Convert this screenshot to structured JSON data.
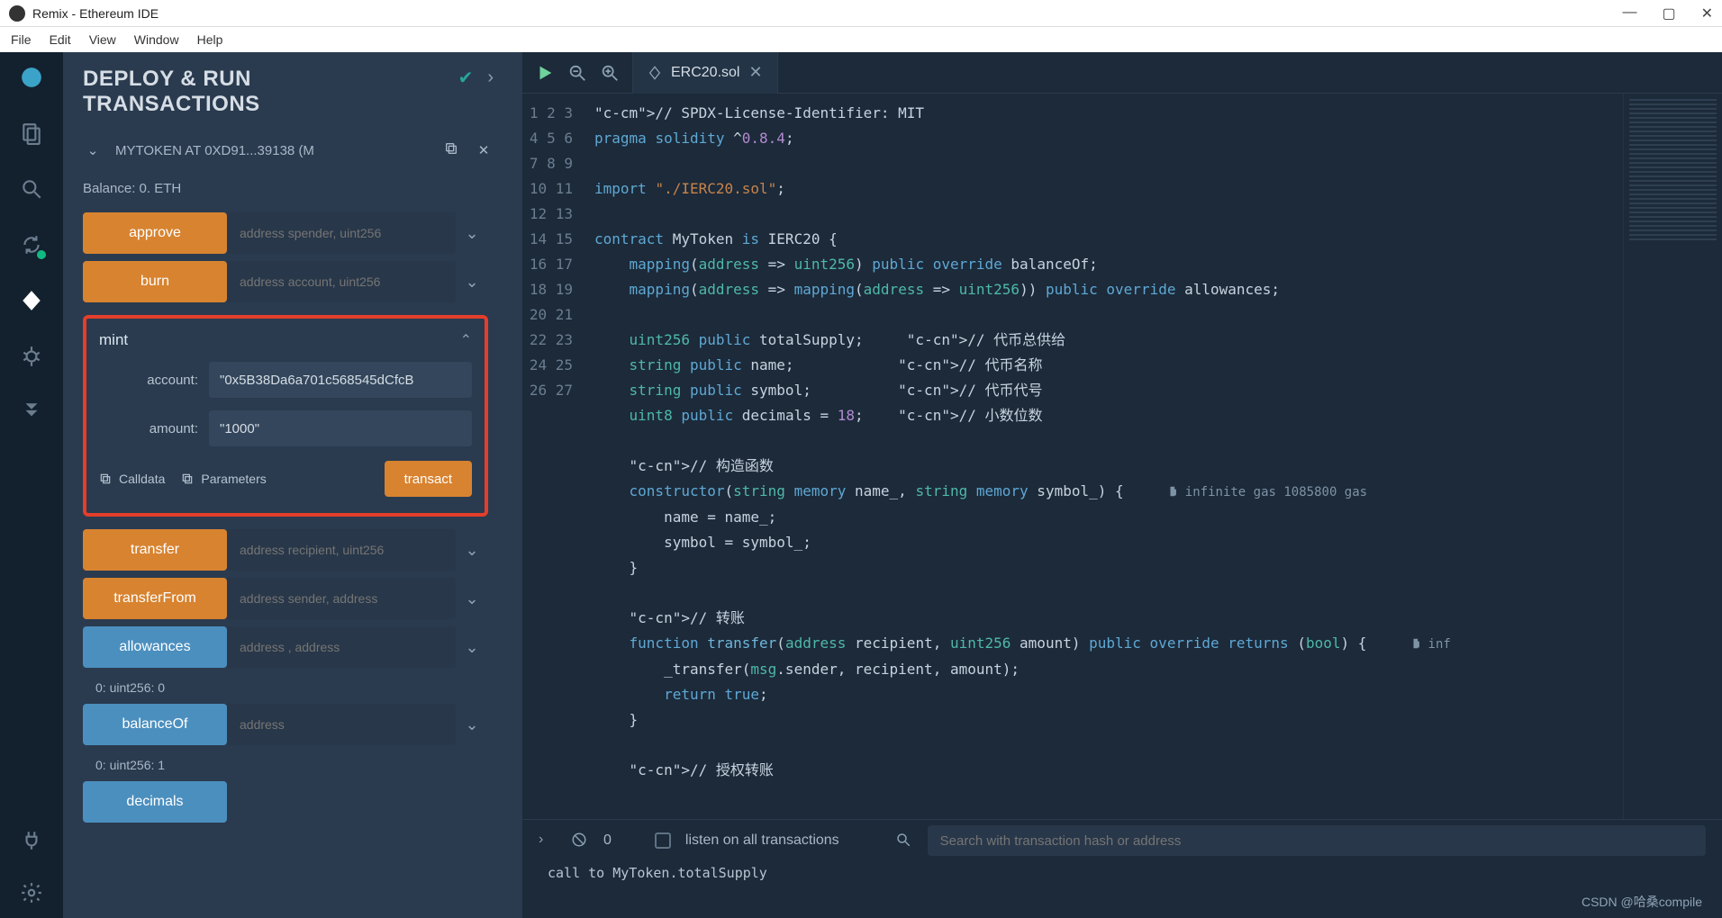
{
  "window": {
    "title": "Remix - Ethereum IDE"
  },
  "menus": [
    "File",
    "Edit",
    "View",
    "Window",
    "Help"
  ],
  "panel": {
    "title_line1": "DEPLOY & RUN",
    "title_line2": "TRANSACTIONS",
    "instance_label": "MYTOKEN AT 0XD91...39138 (M",
    "balance": "Balance: 0. ETH",
    "functions": {
      "approve": {
        "label": "approve",
        "placeholder": "address spender, uint256"
      },
      "burn": {
        "label": "burn",
        "placeholder": "address account, uint256"
      },
      "transfer": {
        "label": "transfer",
        "placeholder": "address recipient, uint256"
      },
      "transferFrom": {
        "label": "transferFrom",
        "placeholder": "address sender, address"
      },
      "allowances": {
        "label": "allowances",
        "placeholder": "address , address"
      },
      "balanceOf": {
        "label": "balanceOf",
        "placeholder": "address"
      },
      "decimals": {
        "label": "decimals"
      }
    },
    "mint": {
      "title": "mint",
      "account_label": "account:",
      "account_value": "\"0x5B38Da6a701c568545dCfcB",
      "amount_label": "amount:",
      "amount_value": "\"1000\"",
      "calldata": "Calldata",
      "parameters": "Parameters",
      "transact": "transact"
    },
    "results": {
      "allowances": "0:  uint256: 0",
      "balanceOf": "0:  uint256: 1"
    }
  },
  "tab": {
    "filename": "ERC20.sol"
  },
  "code_lines": [
    "// SPDX-License-Identifier: MIT",
    "pragma solidity ^0.8.4;",
    "",
    "import \"./IERC20.sol\";",
    "",
    "contract MyToken is IERC20 {",
    "    mapping(address => uint256) public override balanceOf;",
    "    mapping(address => mapping(address => uint256)) public override allowances;",
    "",
    "    uint256 public totalSupply;     // 代币总供给",
    "    string public name;            // 代币名称",
    "    string public symbol;          // 代币代号",
    "    uint8 public decimals = 18;    // 小数位数",
    "",
    "    // 构造函数",
    "    constructor(string memory name_, string memory symbol_) {      infinite gas 1085800 gas",
    "        name = name_;",
    "        symbol = symbol_;",
    "    }",
    "",
    "    // 转账",
    "    function transfer(address recipient, uint256 amount) public override returns (bool) {      inf",
    "        _transfer(msg.sender, recipient, amount);",
    "        return true;",
    "    }",
    "",
    "    // 授权转账"
  ],
  "terminal": {
    "count": "0",
    "listen": "listen on all transactions",
    "search_placeholder": "Search with transaction hash or address",
    "log": "call to MyToken.totalSupply"
  },
  "watermark": "CSDN @哈桑compile"
}
